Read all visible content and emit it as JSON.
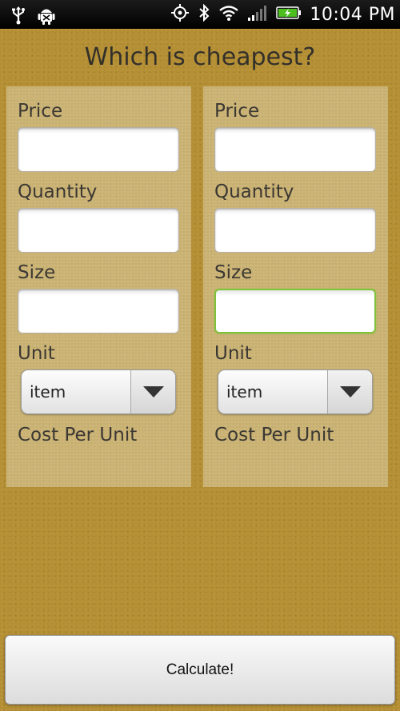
{
  "status_bar": {
    "time": "10:04 PM",
    "icons": [
      "usb-icon",
      "android-debug-icon",
      "gps-icon",
      "bluetooth-icon",
      "wifi-icon",
      "signal-icon",
      "battery-charging-icon"
    ]
  },
  "title": "Which is cheapest?",
  "labels": {
    "price": "Price",
    "quantity": "Quantity",
    "size": "Size",
    "unit": "Unit",
    "cost_per_unit": "Cost Per Unit"
  },
  "left": {
    "price": "",
    "quantity": "",
    "size": "",
    "unit": "item"
  },
  "right": {
    "price": "",
    "quantity": "",
    "size": "",
    "unit": "item"
  },
  "calculate_label": "Calculate!",
  "colors": {
    "background": "#b58f33",
    "panel": "#dccda0",
    "focus": "#7ec13a"
  }
}
